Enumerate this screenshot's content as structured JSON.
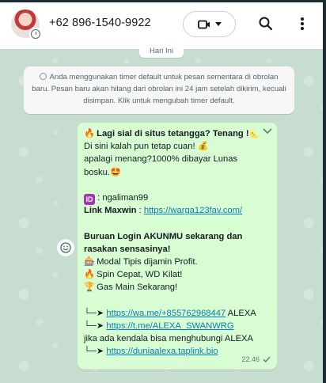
{
  "header": {
    "contact_name": "+62 896-1540-9922"
  },
  "chat": {
    "day_label": "Hari Ini",
    "system_message": "Anda menggunakan timer default untuk pesan sementara di obrolan baru. Pesan baru akan hilang dari obrolan ini 24 jam setelah dikirim, kecuali disimpan. Klik untuk mengubah timer default."
  },
  "message": {
    "l1": "Lagi sial di situs tetangga? Tenang !",
    "l2": "Di sini kalah pun tetap cuan!",
    "l3": "apalagi menang?1000% dibayar Lunas",
    "l4": "bosku.",
    "l5_label": ":  ngaliman99",
    "l6_label": "Link Maxwin",
    "l6_sep": " : ",
    "l6_link": "https://warga123fav.com/",
    "l7": "Buruan Login AKUNMU sekarang dan",
    "l8": "rasakan sensasinya!",
    "l9": "Modal Tipis dijamin Profit.",
    "l10": "Spin Cepat, WD Kilat!",
    "l11": "Gas Main Sekarang!",
    "l12_prefix": "└─➤",
    "l12_link": "https://wa.me/+855762968447",
    "l12_suffix": " ALEXA",
    "l13_prefix": "└─➤",
    "l13_link": "https://t.me/ALEXA_SWANWRG",
    "l14": "jika ada kendala bisa menghubungi ALEXA",
    "l15_prefix": "└─➤",
    "l15_link": "https://duniaalexa.taplink.bio",
    "time": "22.46",
    "bubble_color": "#d9fdd3",
    "link_color": "#027eb5"
  },
  "colors": {
    "chat_bg": "#c7ddd0",
    "icon": "#54656f"
  }
}
